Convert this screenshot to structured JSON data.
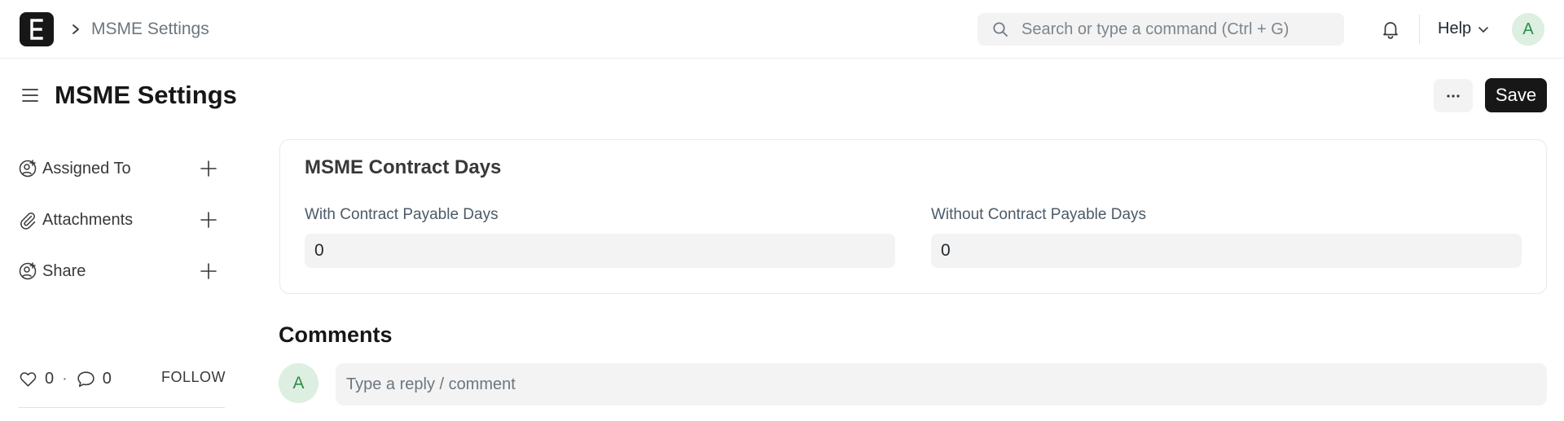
{
  "navbar": {
    "logo_letter": "E",
    "breadcrumb": "MSME Settings",
    "search_placeholder": "Search or type a command (Ctrl + G)",
    "help_label": "Help",
    "user_initial": "A"
  },
  "page": {
    "title": "MSME Settings",
    "more_label": "···",
    "save_label": "Save"
  },
  "sidebar": {
    "items": [
      {
        "label": "Assigned To",
        "icon": "add-user-icon"
      },
      {
        "label": "Attachments",
        "icon": "paperclip-icon"
      },
      {
        "label": "Share",
        "icon": "share-user-icon"
      }
    ],
    "likes": "0",
    "comments": "0",
    "follow_label": "FOLLOW"
  },
  "form": {
    "section_title": "MSME Contract Days",
    "fields": [
      {
        "label": "With Contract Payable Days",
        "value": "0"
      },
      {
        "label": "Without Contract Payable Days",
        "value": "0"
      }
    ]
  },
  "comments": {
    "title": "Comments",
    "user_initial": "A",
    "placeholder": "Type a reply / comment"
  },
  "colors": {
    "primary_button": "#171717",
    "avatar_bg": "#dcefe0",
    "avatar_text": "#2f8a4a",
    "input_bg": "#f3f3f3"
  }
}
